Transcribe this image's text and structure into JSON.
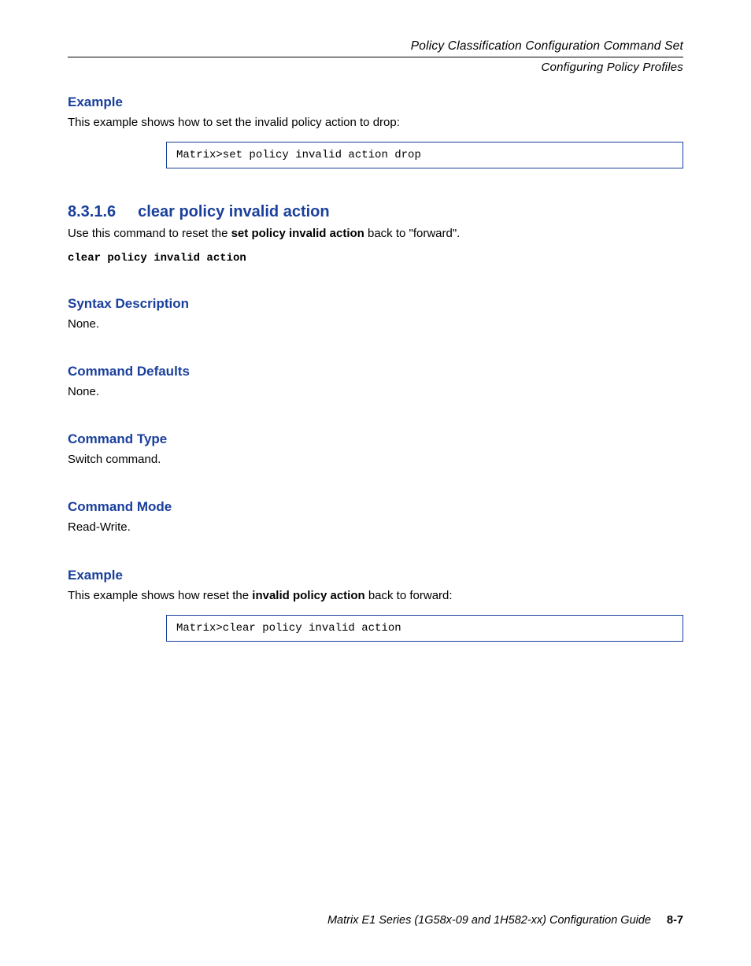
{
  "header": {
    "title": "Policy Classification Configuration Command Set",
    "subtitle": "Configuring Policy Profiles"
  },
  "example1": {
    "heading": "Example",
    "intro": "This example shows how to set the invalid policy action to drop:",
    "code": "Matrix>set policy invalid action drop"
  },
  "command": {
    "number": "8.3.1.6",
    "title": "clear policy invalid action",
    "desc_prefix": "Use this command to reset the ",
    "desc_bold": "set policy invalid action",
    "desc_suffix": " back to \"forward\".",
    "syntax": "clear policy invalid action"
  },
  "sections": {
    "syntax_desc_h": "Syntax Description",
    "syntax_desc_t": "None.",
    "defaults_h": "Command Defaults",
    "defaults_t": "None.",
    "type_h": "Command Type",
    "type_t": "Switch command.",
    "mode_h": "Command Mode",
    "mode_t": "Read-Write."
  },
  "example2": {
    "heading": "Example",
    "intro_prefix": "This example shows how reset the ",
    "intro_bold": "invalid policy action",
    "intro_suffix": " back to forward:",
    "code": "Matrix>clear policy invalid action"
  },
  "footer": {
    "text": "Matrix E1 Series (1G58x-09 and 1H582-xx) Configuration Guide",
    "page": "8-7"
  }
}
